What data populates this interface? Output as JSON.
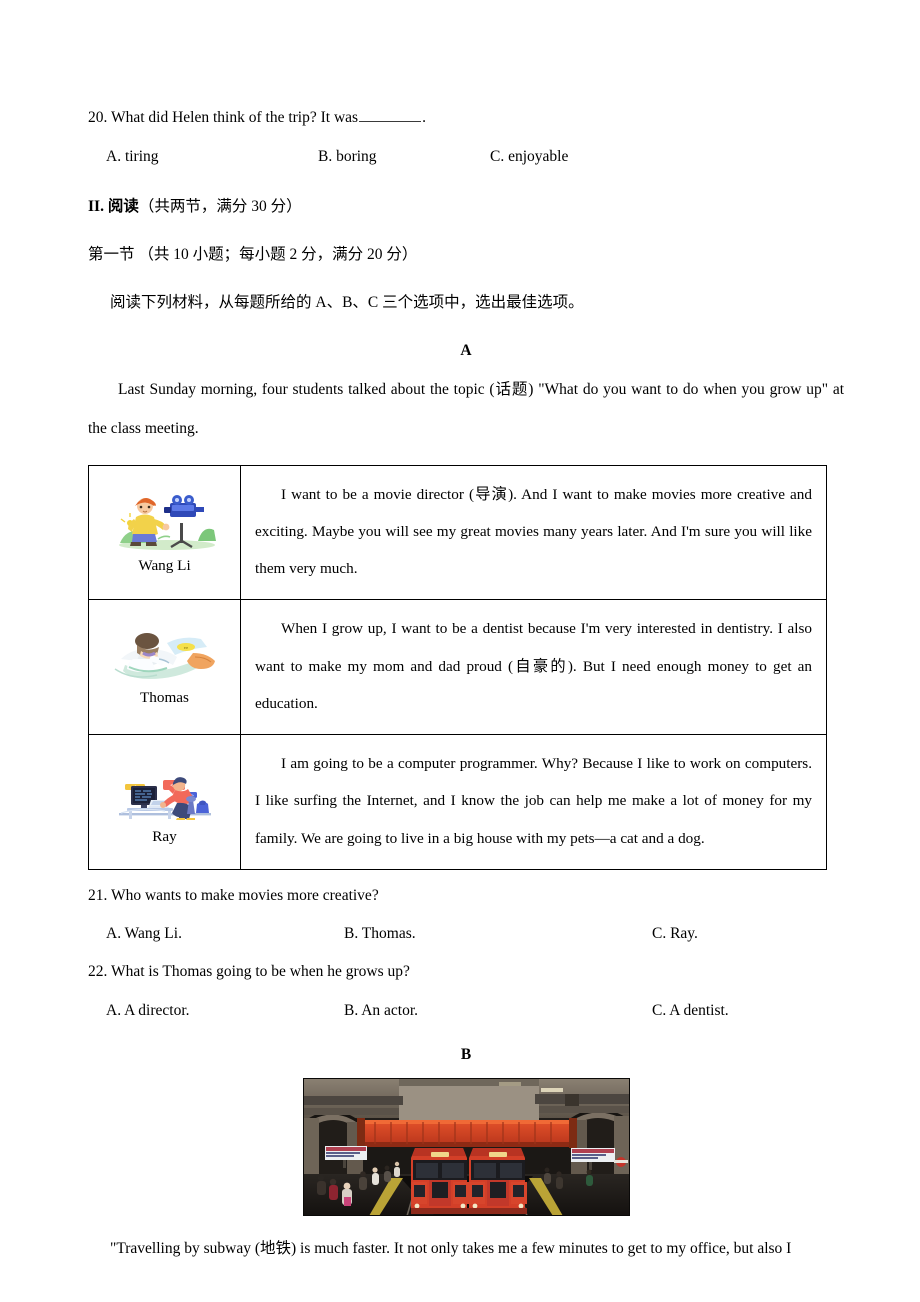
{
  "question20": {
    "number": "20.",
    "stem_before": "What did Helen think of the trip? It was",
    "stem_after": ".",
    "options": [
      "A. tiring",
      "B. boring",
      "C. enjoyable"
    ]
  },
  "section2": {
    "roman": "II.",
    "title_cn": "阅读",
    "title_suffix": "（共两节，满分 30 分）",
    "part1": "第一节 （共 10 小题；每小题 2 分，满分 20 分）",
    "instruction": "阅读下列材料，从每题所给的 A、B、C 三个选项中，选出最佳选项。"
  },
  "passageA": {
    "label": "A",
    "intro_indent": "",
    "intro_line1": "Last Sunday morning, four students talked about the topic (话题) \"What do you want to do when you grow up\"",
    "intro_line2": "at the class meeting.",
    "rows": [
      {
        "name": "Wang Li",
        "icon": "movie-camera-clipart",
        "text": "I want to be a movie director (导演). And I want to make movies more creative and exciting. Maybe you will see my great movies many years later. And I'm sure you will like them very much."
      },
      {
        "name": "Thomas",
        "icon": "dentist-clipart",
        "text": "When I grow up, I want to be a dentist because I'm very interested in dentistry. I also want to make my mom and dad proud (自豪的). But I need enough money to get an education."
      },
      {
        "name": "Ray",
        "icon": "computer-programmer-clipart",
        "text": "I am going to be a computer programmer. Why? Because I like to work on computers. I like surfing the Internet, and I know the job can help me make a lot of money for my family. We are going to live in a big house with my pets—a cat and a dog."
      }
    ]
  },
  "question21": {
    "number": "21.",
    "stem": "Who wants to make movies more creative?",
    "options": [
      "A. Wang Li.",
      "B. Thomas.",
      "C. Ray."
    ]
  },
  "question22": {
    "number": "22.",
    "stem": "What is Thomas going to be when he grows up?",
    "options": [
      "A. A director.",
      "B. An actor.",
      "C. A dentist."
    ]
  },
  "passageB": {
    "label": "B",
    "image_alt": "subway-station-photo",
    "text_line1": "\"Travelling by subway (地铁) is much faster. It not only takes me a few minutes to get to my office, but also I"
  },
  "colors": {
    "ink": "#000000",
    "paper": "#ffffff",
    "train_red": "#d8402c",
    "bridge_red": "#e04a22",
    "platform_yellow": "#d9c23a",
    "station_dark": "#2b2724",
    "station_wall": "#7d7264"
  }
}
